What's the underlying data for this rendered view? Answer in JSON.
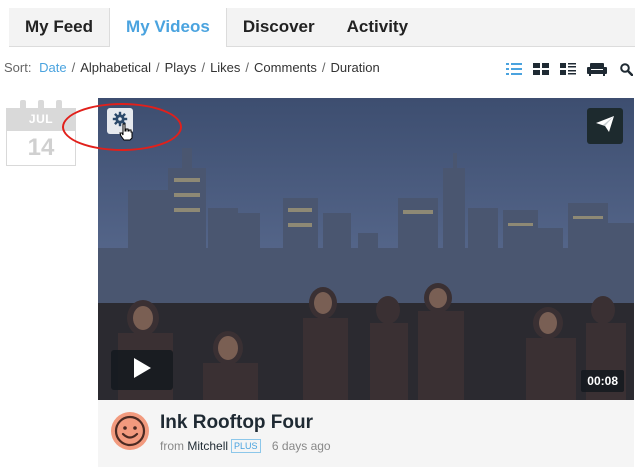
{
  "tabs": [
    {
      "label": "My Feed",
      "active": false
    },
    {
      "label": "My Videos",
      "active": true
    },
    {
      "label": "Discover",
      "active": false
    },
    {
      "label": "Activity",
      "active": false
    }
  ],
  "sort": {
    "label": "Sort:",
    "options": [
      "Date",
      "Alphabetical",
      "Plays",
      "Likes",
      "Comments",
      "Duration"
    ],
    "active": "Date"
  },
  "view_icons": [
    "list-view-icon",
    "grid-view-icon",
    "detail-view-icon",
    "couch-mode-icon",
    "search-icon"
  ],
  "calendar": {
    "month": "JUL",
    "day": "14"
  },
  "video": {
    "duration": "00:08",
    "title": "Ink Rooftop Four",
    "from_label": "from",
    "author": "Mitchell",
    "badge": "PLUS",
    "age": "6 days ago"
  },
  "colors": {
    "accent": "#4aa3df",
    "highlight_circle": "#e1201b",
    "avatar": "#f29a7e"
  }
}
